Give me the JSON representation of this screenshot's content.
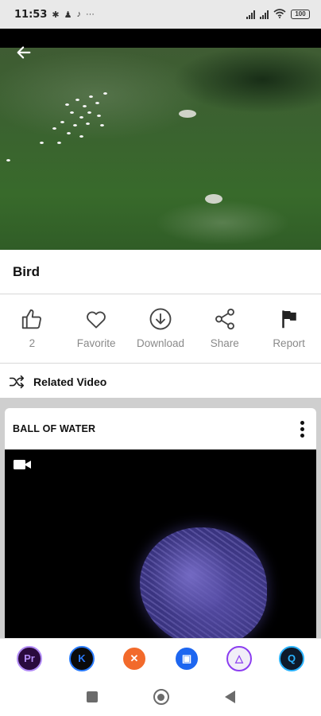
{
  "status_bar": {
    "time": "11:53",
    "battery": "100",
    "icons": [
      "bluetooth-icon",
      "person-icon",
      "tiktok-icon",
      "more-dots-icon",
      "signal-icon",
      "signal-icon",
      "wifi-icon",
      "battery-icon"
    ]
  },
  "video": {
    "title": "Bird",
    "back_icon": "arrow-left-icon"
  },
  "actions": [
    {
      "icon": "thumbs-up-icon",
      "label": "2"
    },
    {
      "icon": "heart-icon",
      "label": "Favorite"
    },
    {
      "icon": "download-icon",
      "label": "Download"
    },
    {
      "icon": "share-icon",
      "label": "Share"
    },
    {
      "icon": "flag-icon",
      "label": "Report"
    }
  ],
  "related": {
    "label": "Related Video",
    "icon": "shuffle-icon"
  },
  "card": {
    "title": "BALL OF WATER",
    "menu_icon": "more-vertical-icon",
    "media_icon": "video-camera-icon"
  },
  "app_bar": [
    {
      "name": "premiere-pro-icon",
      "text": "Pr",
      "color": "#2a0a3d",
      "accent": "#b28bf5"
    },
    {
      "name": "kinemaster-icon",
      "text": "K",
      "color": "#0b0b0b",
      "accent": "#2a7cff"
    },
    {
      "name": "tools-app-icon",
      "text": "✕",
      "color": "#f26a2b",
      "accent": "#ffffff"
    },
    {
      "name": "video-call-app-icon",
      "text": "▣",
      "color": "#1d66f0",
      "accent": "#ffffff"
    },
    {
      "name": "prism-app-icon",
      "text": "△",
      "color": "#f1eef8",
      "accent": "#8b3df0"
    },
    {
      "name": "q-app-icon",
      "text": "Q",
      "color": "#0e1a2a",
      "accent": "#2bb3ff"
    }
  ],
  "nav_bar": [
    "recents-square-icon",
    "home-circle-icon",
    "back-triangle-icon"
  ]
}
